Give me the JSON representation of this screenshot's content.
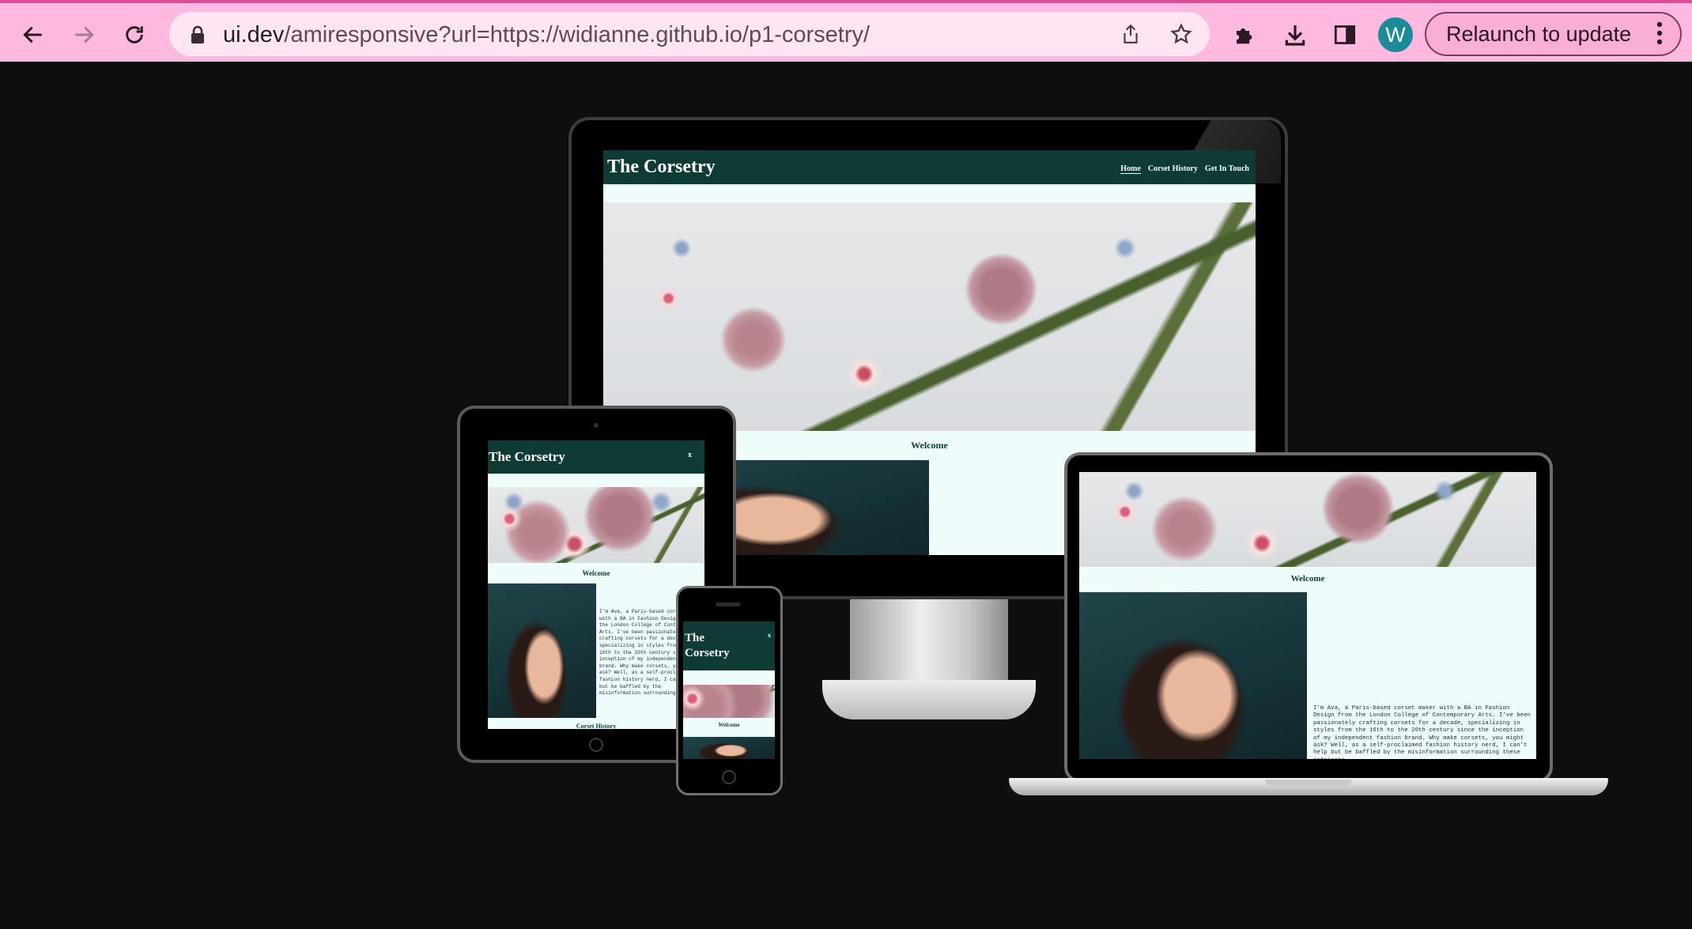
{
  "browser": {
    "url_host": "ui.dev",
    "url_rest": "/amiresponsive?url=https://widianne.github.io/p1-corsetry/",
    "avatar_letter": "W",
    "relaunch_label": "Relaunch to update"
  },
  "site": {
    "title": "The Corsetry",
    "phone_title_line1": "The",
    "phone_title_line2": "Corsetry",
    "nav": [
      "Home",
      "Corset History",
      "Get In Touch"
    ],
    "welcome": "Welcome",
    "section_corset_history": "Corset History",
    "close_glyph": "x",
    "laptop_paragraph": "I'm Ava, a Paris-based corset maker with a BA in Fashion Design from the London College of Contemporary Arts. I've been passionately crafting corsets for a decade, specializing in styles from the 16th to the 20th century since the inception of my independent fashion brand. Why make corsets, you might ask? Well, as a self-proclaimed fashion history nerd, I can't help but be baffled by the misinformation surrounding these intricate",
    "tablet_paragraph": "I'm Ava, a Paris-based corset maker with a BA in Fashion Design from the London College of Contemporary Arts. I've been passionately crafting corsets for a decade, specializing in styles from the 16th to the 20th century since the inception of my independent fashion brand. Why make corsets, you might ask? Well, as a self-proclaimed fashion history nerd, I can't help but be baffled by the misinformation surrounding these intricate garments. I am here to change that!"
  }
}
